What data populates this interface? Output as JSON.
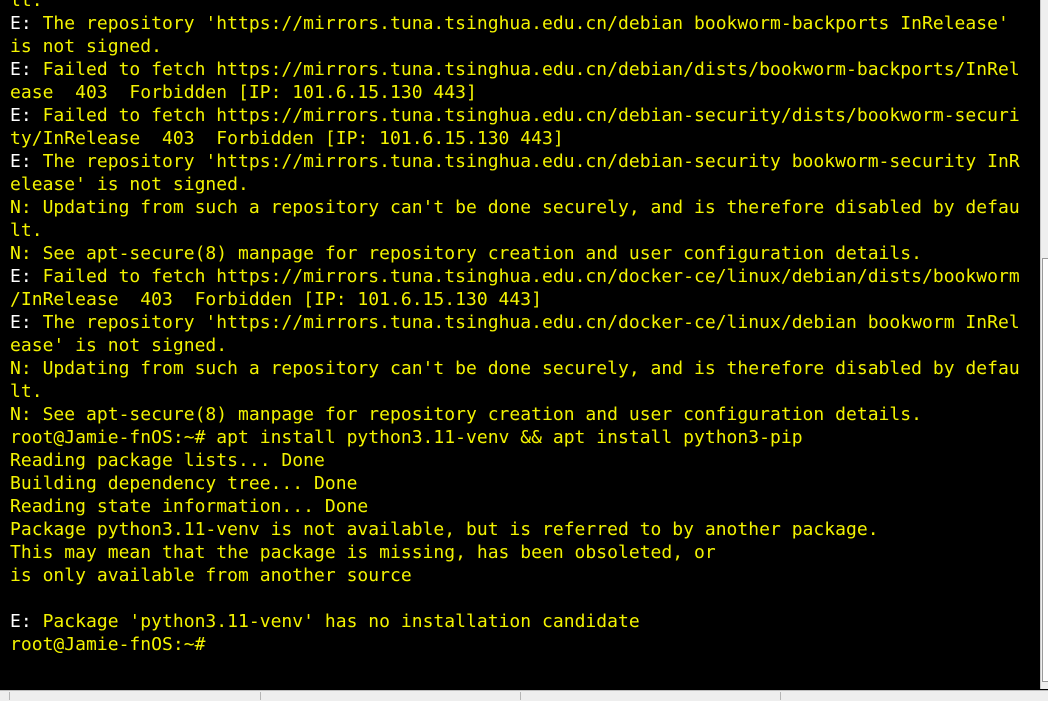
{
  "terminal": {
    "lines": [
      {
        "prefix": "",
        "text": "lt."
      },
      {
        "prefix": "E:",
        "text": " The repository 'https://mirrors.tuna.tsinghua.edu.cn/debian bookworm-backports InRelease'"
      },
      {
        "prefix": "",
        "text": "is not signed."
      },
      {
        "prefix": "E:",
        "text": " Failed to fetch https://mirrors.tuna.tsinghua.edu.cn/debian/dists/bookworm-backports/InRel"
      },
      {
        "prefix": "",
        "text": "ease  403  Forbidden [IP: 101.6.15.130 443]"
      },
      {
        "prefix": "E:",
        "text": " Failed to fetch https://mirrors.tuna.tsinghua.edu.cn/debian-security/dists/bookworm-securi"
      },
      {
        "prefix": "",
        "text": "ty/InRelease  403  Forbidden [IP: 101.6.15.130 443]"
      },
      {
        "prefix": "E:",
        "text": " The repository 'https://mirrors.tuna.tsinghua.edu.cn/debian-security bookworm-security InR"
      },
      {
        "prefix": "",
        "text": "elease' is not signed."
      },
      {
        "prefix": "",
        "text": "N: Updating from such a repository can't be done securely, and is therefore disabled by defau"
      },
      {
        "prefix": "",
        "text": "lt."
      },
      {
        "prefix": "",
        "text": "N: See apt-secure(8) manpage for repository creation and user configuration details."
      },
      {
        "prefix": "E:",
        "text": " Failed to fetch https://mirrors.tuna.tsinghua.edu.cn/docker-ce/linux/debian/dists/bookworm"
      },
      {
        "prefix": "",
        "text": "/InRelease  403  Forbidden [IP: 101.6.15.130 443]"
      },
      {
        "prefix": "E:",
        "text": " The repository 'https://mirrors.tuna.tsinghua.edu.cn/docker-ce/linux/debian bookworm InRel"
      },
      {
        "prefix": "",
        "text": "ease' is not signed."
      },
      {
        "prefix": "",
        "text": "N: Updating from such a repository can't be done securely, and is therefore disabled by defau"
      },
      {
        "prefix": "",
        "text": "lt."
      },
      {
        "prefix": "",
        "text": "N: See apt-secure(8) manpage for repository creation and user configuration details."
      },
      {
        "prefix": "",
        "text": "root@Jamie-fnOS:~# apt install python3.11-venv && apt install python3-pip"
      },
      {
        "prefix": "",
        "text": "Reading package lists... Done"
      },
      {
        "prefix": "",
        "text": "Building dependency tree... Done"
      },
      {
        "prefix": "",
        "text": "Reading state information... Done"
      },
      {
        "prefix": "",
        "text": "Package python3.11-venv is not available, but is referred to by another package."
      },
      {
        "prefix": "",
        "text": "This may mean that the package is missing, has been obsoleted, or"
      },
      {
        "prefix": "",
        "text": "is only available from another source"
      },
      {
        "prefix": "",
        "text": ""
      },
      {
        "prefix": "E:",
        "text": " Package 'python3.11-venv' has no installation candidate"
      },
      {
        "prefix": "",
        "text": "root@Jamie-fnOS:~#"
      }
    ]
  },
  "colors": {
    "background": "#000000",
    "text": "#f3f300",
    "error_prefix": "#ffffff"
  }
}
